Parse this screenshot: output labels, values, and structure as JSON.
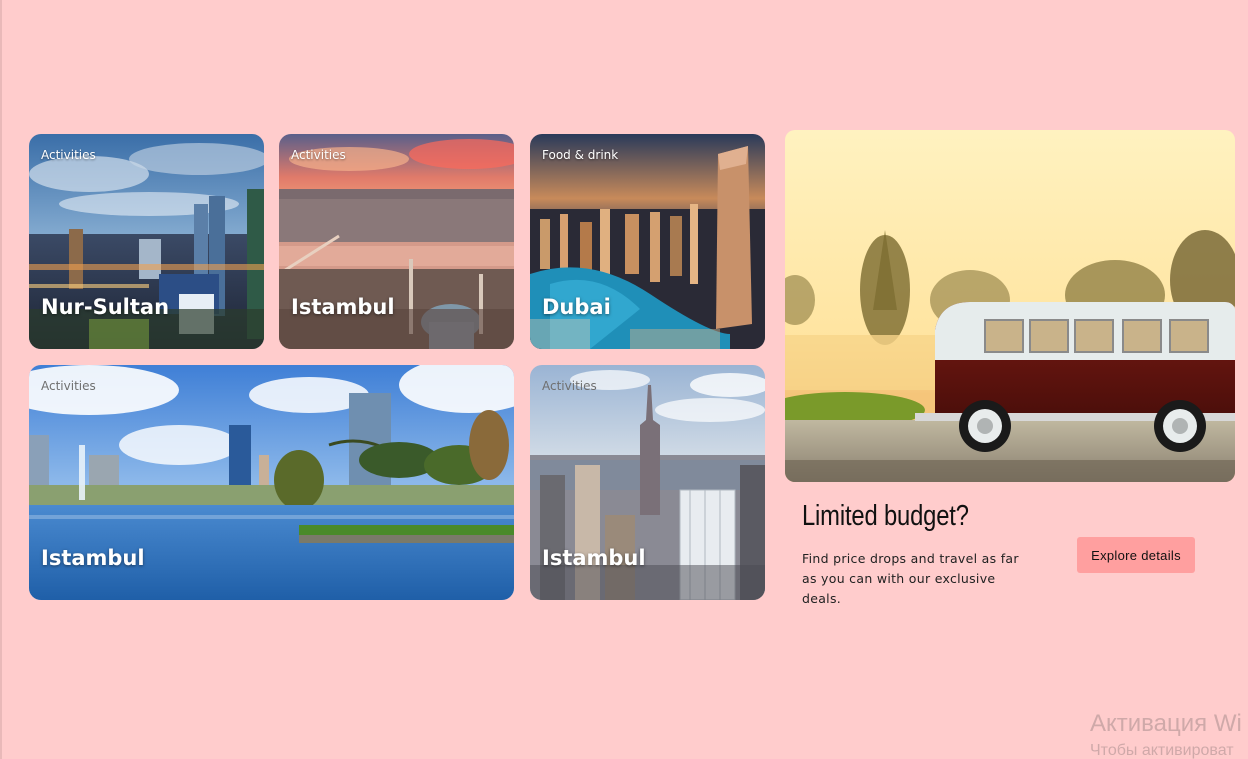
{
  "cards": [
    {
      "tag": "Activities",
      "city": "Nur-Sultan"
    },
    {
      "tag": "Activities",
      "city": "Istambul"
    },
    {
      "tag": "Food & drink",
      "city": "Dubai"
    },
    {
      "tag": "Activities",
      "city": "Istambul"
    },
    {
      "tag": "Activities",
      "city": "Istambul"
    }
  ],
  "promo": {
    "title": "Limited budget?",
    "text": "Find price drops and travel as far as you can with our exclusive deals.",
    "button": "Explore details"
  },
  "watermark": {
    "line1": "Активация Wi",
    "line2": "Чтобы активироват"
  },
  "colors": {
    "background": "#ffcccc",
    "button": "#ff9f9f"
  }
}
